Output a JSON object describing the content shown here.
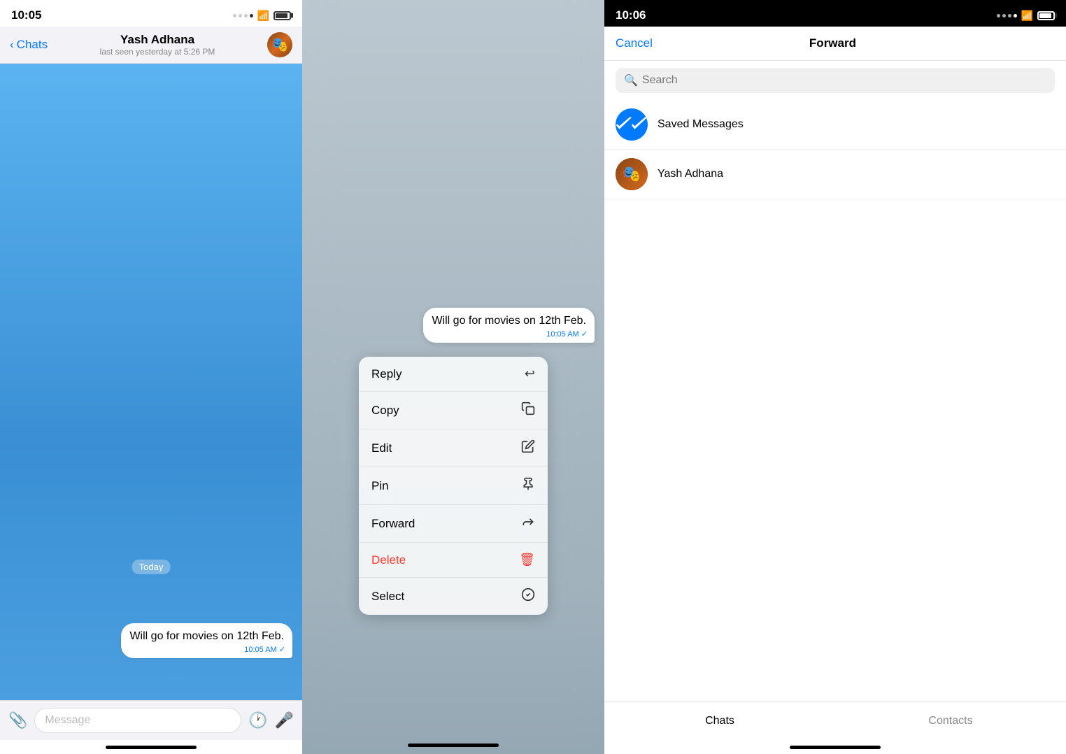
{
  "panel1": {
    "status_bar": {
      "time": "10:05"
    },
    "nav": {
      "back_label": "Chats",
      "contact_name": "Yash Adhana",
      "contact_status": "last seen yesterday at 5:26 PM"
    },
    "chat": {
      "date_label": "Today",
      "message_text": "Will go for movies on 12th Feb.",
      "message_time": "10:05 AM",
      "input_placeholder": "Message"
    }
  },
  "panel2": {
    "message_text": "Will go for movies on 12th Feb.",
    "message_time": "10:05 AM",
    "menu_items": [
      {
        "label": "Reply",
        "icon": "↩",
        "id": "reply"
      },
      {
        "label": "Copy",
        "icon": "⧉",
        "id": "copy"
      },
      {
        "label": "Edit",
        "icon": "✎",
        "id": "edit"
      },
      {
        "label": "Pin",
        "icon": "📌",
        "id": "pin"
      },
      {
        "label": "Forward",
        "icon": "↪",
        "id": "forward"
      },
      {
        "label": "Delete",
        "icon": "🗑",
        "id": "delete",
        "is_delete": true
      },
      {
        "label": "Select",
        "icon": "✓",
        "id": "select"
      }
    ]
  },
  "panel3": {
    "status_bar": {
      "time": "10:06"
    },
    "nav": {
      "cancel_label": "Cancel",
      "title": "Forward"
    },
    "search": {
      "placeholder": "Search"
    },
    "contacts": [
      {
        "name": "Saved Messages",
        "type": "saved"
      },
      {
        "name": "Yash Adhana",
        "type": "user"
      }
    ],
    "tabs": [
      {
        "label": "Chats",
        "active": true
      },
      {
        "label": "Contacts",
        "active": false
      }
    ]
  }
}
